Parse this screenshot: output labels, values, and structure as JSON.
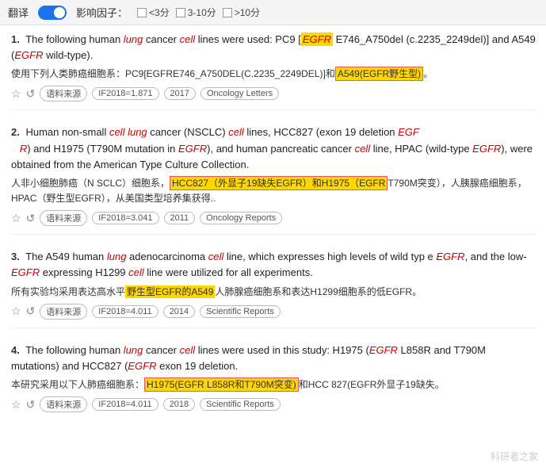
{
  "topbar": {
    "translate_label": "翻译",
    "toggle_on": true,
    "influence_label": "影响因子：",
    "filters": [
      {
        "label": "<3分",
        "checked": false
      },
      {
        "label": "3-10分",
        "checked": false
      },
      {
        "label": ">10分",
        "checked": false
      }
    ]
  },
  "results": [
    {
      "number": "1.",
      "en_text_parts": [
        {
          "text": "The following human ",
          "style": "normal"
        },
        {
          "text": "lung",
          "style": "italic-red"
        },
        {
          "text": " cancer ",
          "style": "normal"
        },
        {
          "text": "cell",
          "style": "italic-red"
        },
        {
          "text": " lines were used: PC9 [",
          "style": "normal"
        },
        {
          "text": "EGFR",
          "style": "italic-red-box"
        },
        {
          "text": " E746_A750del (c.2235_2249del)] and A549 (",
          "style": "normal"
        },
        {
          "text": "EGFR",
          "style": "italic-red"
        },
        {
          "text": " wild-type).",
          "style": "normal"
        }
      ],
      "en_text": "The following human lung cancer cell lines were used: PC9 [EGFR E746_A750del (c.2235_2249del)] and A549 (EGFR wild-type).",
      "zh_text": "使用下列人类肺癌细胞系：PC9[EGFRE746_A750DEL(C.2235_2249DEL)]和",
      "zh_highlight": "A549(EGFR野生型)。",
      "zh_highlight_type": "yellow-border",
      "star": "☆",
      "refresh": "↺",
      "source_tag": "语料来源",
      "if_tag": "IF2018=1.871",
      "year_tag": "2017",
      "journal_tag": "Oncology Letters"
    },
    {
      "number": "2.",
      "en_text": "Human non-small cell lung cancer (NSCLC) cell lines, HCC827 (exon 19 deletion EGFR) and H1975 (T790M mutation in EGFR), and human pancreatic cancer cell line, HPAC (wild-type EGFR), were obtained from the American Type Culture Collection.",
      "zh_text_pre": "人非小细胞肺癌（N SCLC）细胞系，",
      "zh_highlight1": "HCC827（外显子19缺失EGFR）和H1975（EGFR",
      "zh_highlight1_type": "yellow-border",
      "zh_text_mid": "T790M突变），人胰腺癌细胞系，HPAC（野生型EGFR），从美国类型培养集获得..",
      "star": "☆",
      "refresh": "↺",
      "source_tag": "语料来源",
      "if_tag": "IF2018=3.041",
      "year_tag": "2011",
      "journal_tag": "Oncology Reports"
    },
    {
      "number": "3.",
      "en_text": "The A549 human lung adenocarcinoma cell line, which expresses high levels of wild type EGFR, and the low-EGFR expressing H1299 cell line were utilized for all experiments.",
      "zh_text_pre": "所有实验均采用表达高水平",
      "zh_highlight": "野生型EGFR的A549",
      "zh_highlight_type": "yellow",
      "zh_text_post": "人肺腺癌细胞系和表达H1299细胞系的低EGFR。",
      "star": "☆",
      "refresh": "↺",
      "source_tag": "语料来源",
      "if_tag": "IF2018=4.011",
      "year_tag": "2014",
      "journal_tag": "Scientific Reports"
    },
    {
      "number": "4.",
      "en_text": "The following human lung cancer cell lines were used in this study: H1975 (EGFR L858R and T790M mutations) and HCC827 (EGFR exon 19 deletion.",
      "zh_text_pre": "本研究采用以下人肺癌细胞系：",
      "zh_highlight": "H1975(EGFR L858R和T790M突变)",
      "zh_highlight_type": "yellow-border",
      "zh_text_post": "和HCC 827(EGFR外显子19缺失。",
      "star": "☆",
      "refresh": "↺",
      "source_tag": "语料来源",
      "if_tag": "IF2018=4.011",
      "year_tag": "2018",
      "journal_tag": "Scientific Reports"
    }
  ],
  "watermark": "科研者之家"
}
